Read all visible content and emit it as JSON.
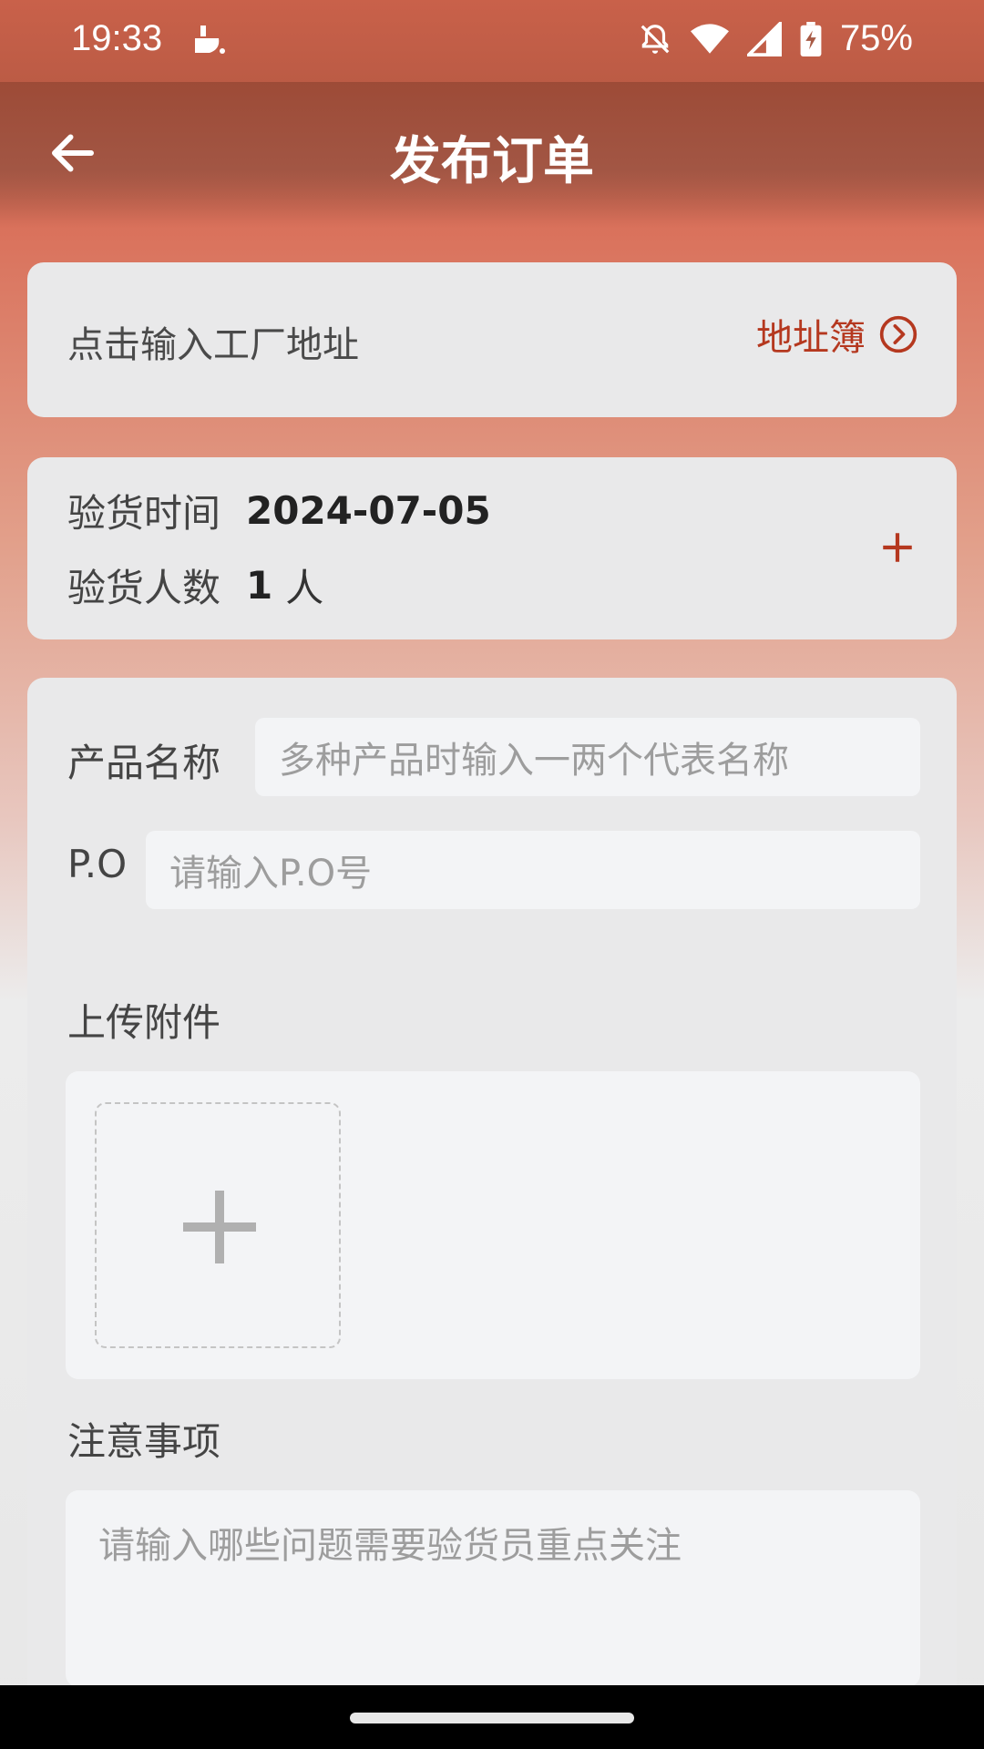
{
  "status_bar": {
    "time": "19:33",
    "battery": "75%",
    "icons": [
      "app-notification-icon",
      "bell-off-icon",
      "wifi-icon",
      "cell-signal-icon",
      "battery-charging-icon"
    ]
  },
  "header": {
    "title": "发布订单",
    "back_icon": "back-arrow-icon"
  },
  "address": {
    "placeholder": "点击输入工厂地址",
    "book_label": "地址簿",
    "book_icon": "chevron-right-circle-icon"
  },
  "inspection": {
    "date_label": "验货时间",
    "date_value": "2024-07-05",
    "count_label": "验货人数",
    "count_value": "1",
    "count_unit": "人",
    "add_icon": "plus-icon"
  },
  "form": {
    "product_label": "产品名称",
    "product_placeholder": "多种产品时输入一两个代表名称",
    "po_label": "P.O",
    "po_placeholder": "请输入P.O号",
    "upload_label": "上传附件",
    "upload_icon": "plus-icon",
    "notes_label": "注意事项",
    "notes_placeholder": "请输入哪些问题需要验货员重点关注"
  },
  "colors": {
    "accent": "#b5381f",
    "header_bg": "#9d4b37",
    "card_bg": "#e9e9ea",
    "input_bg": "#f3f4f6"
  }
}
